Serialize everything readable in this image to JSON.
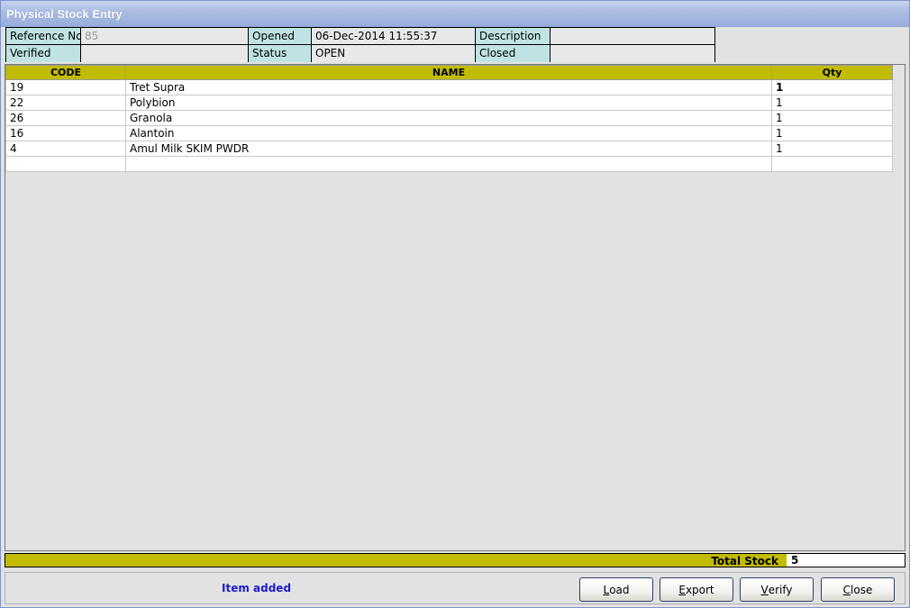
{
  "window": {
    "title": "Physical Stock Entry"
  },
  "info": {
    "reference_no_label": "Reference No",
    "reference_no_value": "85",
    "opened_label": "Opened",
    "opened_value": "06-Dec-2014 11:55:37",
    "description_label": "Description",
    "description_value": "",
    "verified_label": "Verified",
    "verified_value": "",
    "status_label": "Status",
    "status_value": "OPEN",
    "closed_label": "Closed",
    "closed_value": ""
  },
  "grid": {
    "columns": [
      "CODE",
      "NAME",
      "Qty"
    ],
    "rows": [
      {
        "code": "19",
        "name": "Tret Supra",
        "qty": "1"
      },
      {
        "code": "22",
        "name": "Polybion",
        "qty": "1"
      },
      {
        "code": "26",
        "name": "Granola",
        "qty": "1"
      },
      {
        "code": "16",
        "name": "Alantoin",
        "qty": "1"
      },
      {
        "code": "4",
        "name": "Amul Milk SKIM PWDR",
        "qty": "1"
      },
      {
        "code": "",
        "name": "",
        "qty": ""
      }
    ]
  },
  "total": {
    "label": "Total Stock",
    "value": "5"
  },
  "status_message": "Item added",
  "buttons": {
    "load": {
      "first": "L",
      "rest": "oad"
    },
    "export": {
      "first": "E",
      "rest": "xport"
    },
    "verify": {
      "first": "V",
      "rest": "erify"
    },
    "close": {
      "first": "C",
      "rest": "lose"
    }
  },
  "colors": {
    "header_yellow": "#c2bc00",
    "label_cyan": "#bfe3e3",
    "status_blue": "#1c1cc8"
  }
}
